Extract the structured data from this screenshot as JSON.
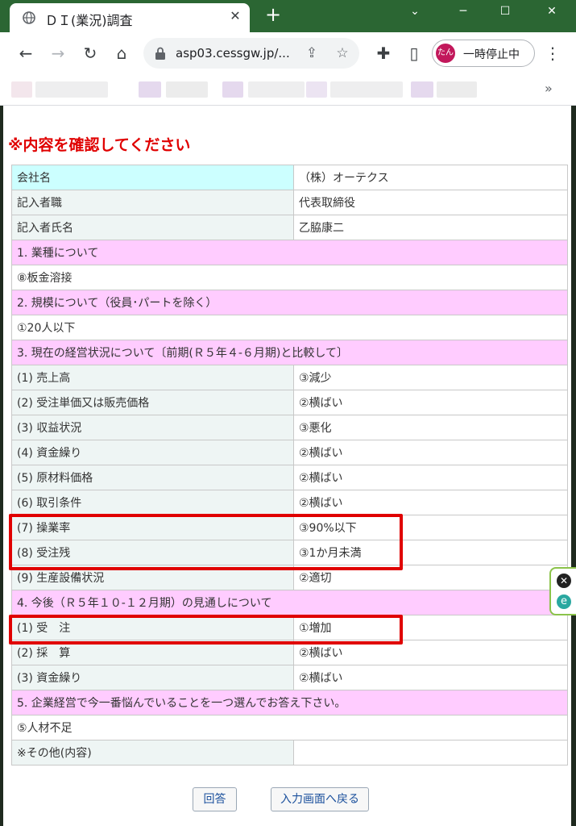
{
  "browser": {
    "tab_title": "ＤＩ(業況)調査",
    "tab_close": "✕",
    "new_tab": "+",
    "url": "asp03.cessgw.jp/...",
    "profile_avatar": "たん",
    "profile_status": "一時停止中",
    "bookmarks_more": "»",
    "icons": {
      "back": "←",
      "forward": "→",
      "reload": "↻",
      "home": "⌂",
      "share": "⇪",
      "star": "☆",
      "extensions": "✚",
      "sidepanel": "▯",
      "menu": "⋮",
      "minimize": "─",
      "maximize": "☐",
      "close": "✕",
      "chevron": "⌄"
    }
  },
  "page": {
    "notice": "※内容を確認してください",
    "info_rows": [
      {
        "label": "会社名",
        "value": "（株）オーテクス"
      },
      {
        "label": "記入者職",
        "value": "代表取締役"
      },
      {
        "label": "記入者氏名",
        "value": "乙脇康二"
      }
    ],
    "q1": {
      "title": "1.  業種について",
      "answer": "⑧板金溶接"
    },
    "q2": {
      "title": "2.  規模について（役員･パートを除く）",
      "answer": "①20人以下"
    },
    "q3": {
      "title": "3.  現在の経営状況について〔前期(Ｒ５年４-６月期)と比較して〕",
      "rows": [
        {
          "label": "(1) 売上高",
          "value": "③減少"
        },
        {
          "label": "(2) 受注単価又は販売価格",
          "value": "②横ばい"
        },
        {
          "label": "(3) 収益状況",
          "value": "③悪化"
        },
        {
          "label": "(4) 資金繰り",
          "value": "②横ばい"
        },
        {
          "label": "(5) 原材料価格",
          "value": "②横ばい"
        },
        {
          "label": "(6) 取引条件",
          "value": "②横ばい"
        },
        {
          "label": "(7) 操業率",
          "value": "③90%以下"
        },
        {
          "label": "(8) 受注残",
          "value": "③1か月未満"
        },
        {
          "label": "(9) 生産設備状況",
          "value": "②適切"
        }
      ]
    },
    "q4": {
      "title": "4.  今後（Ｒ５年１０-１２月期）の見通しについて",
      "rows": [
        {
          "label": "(1) 受　注",
          "value": "①増加"
        },
        {
          "label": "(2) 採　算",
          "value": "②横ばい"
        },
        {
          "label": "(3) 資金繰り",
          "value": "②横ばい"
        }
      ]
    },
    "q5": {
      "title": "5.  企業経営で今一番悩んでいることを一つ選んでお答え下さい。",
      "answer": "⑤人材不足"
    },
    "other": {
      "label": "※その他(内容)",
      "value": ""
    },
    "buttons": {
      "submit": "回答",
      "back": "入力画面へ戻る"
    },
    "side_ext": {
      "close": "✕",
      "ext": "e"
    }
  },
  "colors": {
    "header_cell": "#ccffff",
    "section_row": "#ffccff",
    "label_cell": "#eef5f4",
    "highlight_box": "#e00000",
    "notice_text": "#e00000",
    "tab_strip": "#2b6633"
  }
}
